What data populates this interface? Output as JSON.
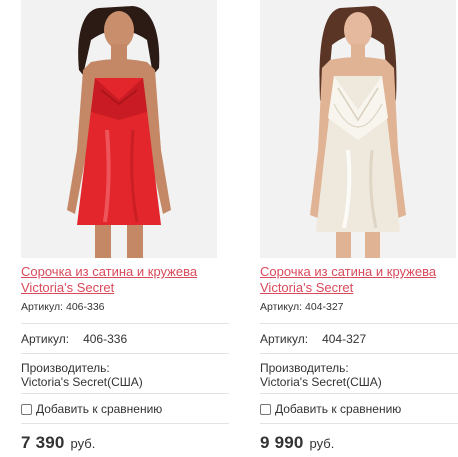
{
  "products": [
    {
      "title": "Сорочка из сатина и кружева Victoria's Secret",
      "sku_small": "Артикул: 406-336",
      "sku_label": "Артикул:",
      "sku_value": "406-336",
      "maker_label": "Производитель:",
      "maker_value": "Victoria's Secret(США)",
      "compare_label": "Добавить к сравнению",
      "price": "7 390",
      "currency": "руб.",
      "dress_color": "#e3262c",
      "image_alt": "red-satin-lace-slip"
    },
    {
      "title": "Сорочка из сатина и кружева Victoria's Secret",
      "sku_small": "Артикул: 404-327",
      "sku_label": "Артикул:",
      "sku_value": "404-327",
      "maker_label": "Производитель:",
      "maker_value": "Victoria's Secret(США)",
      "compare_label": "Добавить к сравнению",
      "price": "9 990",
      "currency": "руб.",
      "dress_color": "#efe9dd",
      "image_alt": "ivory-satin-lace-slip"
    }
  ]
}
